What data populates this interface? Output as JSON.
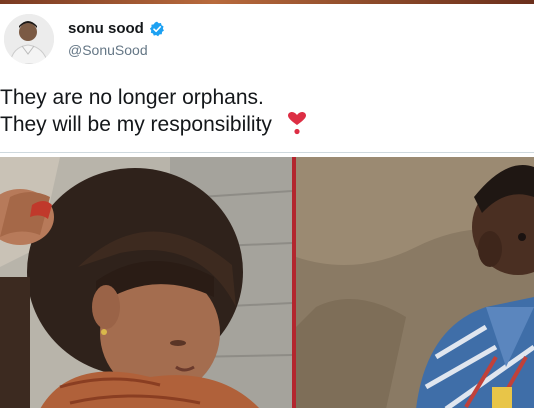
{
  "tweet": {
    "display_name": "sonu sood",
    "handle": "@SonuSood",
    "text_lines": [
      "They are no longer orphans.",
      "They will be my responsibility"
    ],
    "emoji": "heart-exclamation-icon"
  },
  "media": {
    "photos": [
      "girl-photo",
      "boy-photo"
    ]
  },
  "colors": {
    "verified": "#1da1f2",
    "heart": "#dd2e44",
    "divider": "#b3262e"
  }
}
